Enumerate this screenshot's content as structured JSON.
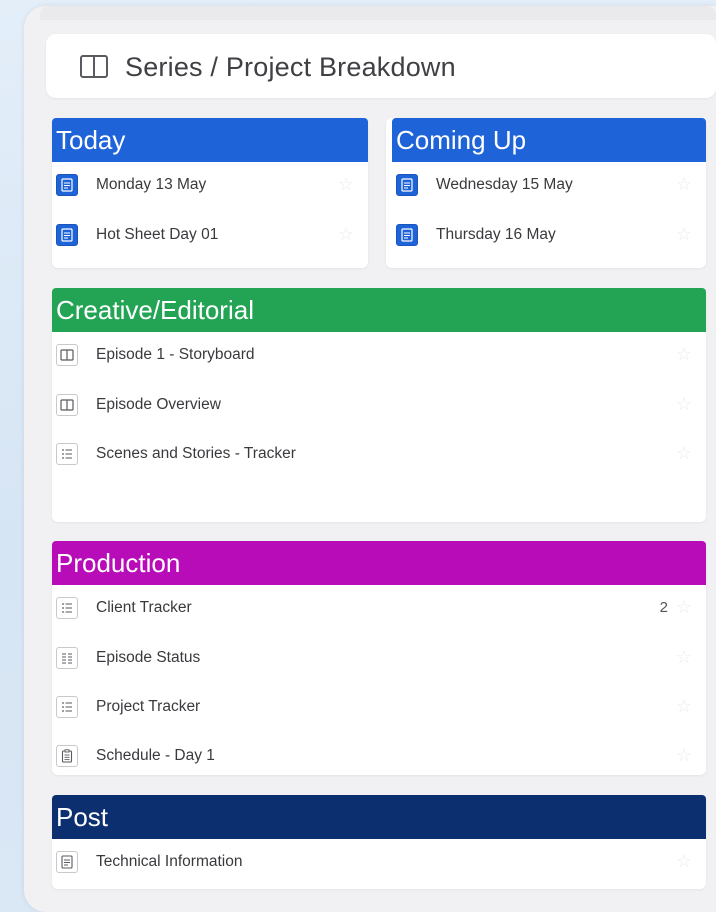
{
  "header": {
    "title": "Series / Project Breakdown",
    "icon": "split-layout-icon"
  },
  "today": {
    "label": "Today",
    "color": "#1f63d8",
    "items": [
      {
        "label": "Monday 13 May",
        "icon": "document-icon"
      },
      {
        "label": "Hot Sheet Day 01",
        "icon": "document-icon"
      }
    ]
  },
  "coming_up": {
    "label": "Coming Up",
    "color": "#1f63d8",
    "items": [
      {
        "label": "Wednesday 15 May",
        "icon": "document-icon"
      },
      {
        "label": "Thursday 16 May",
        "icon": "document-icon"
      }
    ]
  },
  "creative": {
    "label": "Creative/Editorial",
    "color": "#23a455",
    "items": [
      {
        "label": "Episode 1 - Storyboard",
        "icon": "split-layout-icon"
      },
      {
        "label": "Episode Overview",
        "icon": "split-layout-icon"
      },
      {
        "label": "Scenes and Stories - Tracker",
        "icon": "list-icon"
      }
    ]
  },
  "production": {
    "label": "Production",
    "color": "#b80cb9",
    "items": [
      {
        "label": "Client Tracker",
        "icon": "list-icon",
        "count": "2"
      },
      {
        "label": "Episode Status",
        "icon": "table-list-icon"
      },
      {
        "label": "Project Tracker",
        "icon": "list-icon"
      },
      {
        "label": "Schedule - Day 1",
        "icon": "clipboard-icon"
      }
    ]
  },
  "post": {
    "label": "Post",
    "color": "#0c2f70",
    "items": [
      {
        "label": "Technical Information",
        "icon": "document-icon"
      }
    ]
  },
  "star_glyph": "☆"
}
